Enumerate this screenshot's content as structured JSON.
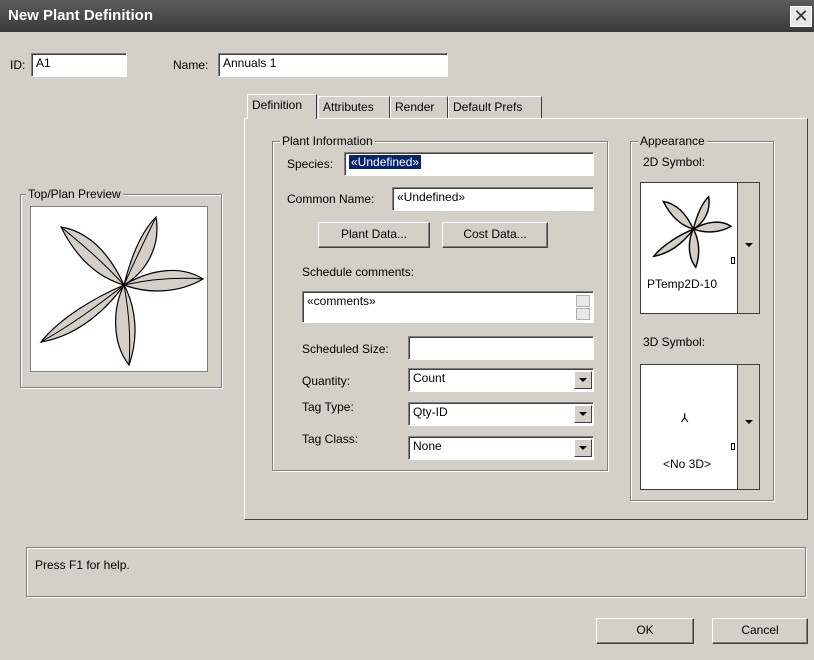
{
  "window": {
    "title": "New Plant Definition",
    "close": "✕"
  },
  "id_field": {
    "label": "ID:",
    "value": "A1"
  },
  "name_field": {
    "label": "Name:",
    "value": "Annuals 1"
  },
  "tabs": [
    {
      "label": "Definition"
    },
    {
      "label": "Attributes"
    },
    {
      "label": "Render"
    },
    {
      "label": "Default Prefs"
    }
  ],
  "preview": {
    "title": "Top/Plan Preview"
  },
  "plant_info": {
    "title": "Plant Information",
    "species_label": "Species:",
    "species_value": "«Undefined»",
    "common_name_label": "Common Name:",
    "common_name_value": "«Undefined»",
    "plant_data_button": "Plant Data...",
    "cost_data_button": "Cost Data...",
    "schedule_comments_label": "Schedule comments:",
    "comments_value": "«comments»",
    "scheduled_size_label": "Scheduled Size:",
    "scheduled_size_value": "",
    "quantity_label": "Quantity:",
    "quantity_value": "Count",
    "tag_type_label": "Tag Type:",
    "tag_type_value": "Qty-ID",
    "tag_class_label": "Tag Class:",
    "tag_class_value": "None"
  },
  "appearance": {
    "title": "Appearance",
    "symbol_2d_label": "2D Symbol:",
    "symbol_2d_name": "PTemp2D-10",
    "symbol_3d_label": "3D Symbol:",
    "symbol_3d_name": "<No 3D>"
  },
  "status": {
    "text": "Press F1 for help."
  },
  "buttons": {
    "ok": "OK",
    "cancel": "Cancel"
  }
}
